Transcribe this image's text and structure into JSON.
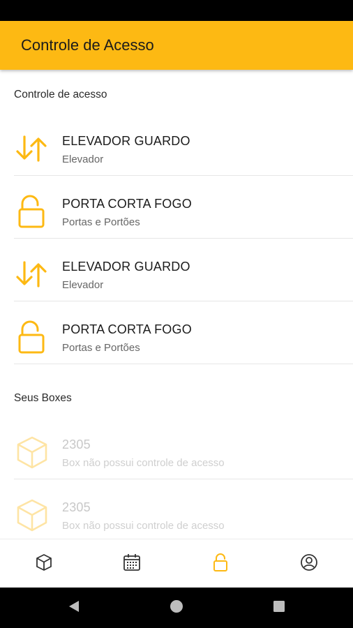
{
  "app_bar": {
    "title": "Controle de Acesso"
  },
  "sections": {
    "access_label": "Controle de acesso",
    "boxes_label": "Seus Boxes"
  },
  "access_items": [
    {
      "title": "ELEVADOR GUARDO",
      "subtitle": "Elevador",
      "icon": "arrows-up-down-icon"
    },
    {
      "title": "PORTA CORTA FOGO",
      "subtitle": "Portas e Portões",
      "icon": "unlock-icon"
    },
    {
      "title": "ELEVADOR GUARDO",
      "subtitle": "Elevador",
      "icon": "arrows-up-down-icon"
    },
    {
      "title": "PORTA CORTA FOGO",
      "subtitle": "Portas e Portões",
      "icon": "unlock-icon"
    }
  ],
  "box_items": [
    {
      "title": "2305",
      "subtitle": "Box não possui controle de acesso",
      "icon": "box-icon"
    },
    {
      "title": "2305",
      "subtitle": "Box não possui controle de acesso",
      "icon": "box-icon"
    }
  ],
  "bottom_nav": [
    {
      "icon": "box-icon",
      "active": false
    },
    {
      "icon": "calendar-icon",
      "active": false
    },
    {
      "icon": "unlock-icon",
      "active": true
    },
    {
      "icon": "account-icon",
      "active": false
    }
  ],
  "colors": {
    "accent": "#FDB913",
    "text": "#1b1b1b",
    "muted": "#666666",
    "disabled": "#c8c8c8"
  }
}
